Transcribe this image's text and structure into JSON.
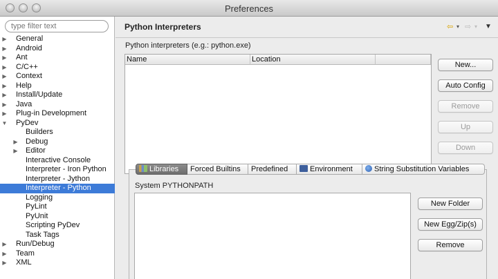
{
  "window": {
    "title": "Preferences"
  },
  "sidebar": {
    "filter_placeholder": "type filter text",
    "items": [
      {
        "label": "General",
        "expander": "collapsed"
      },
      {
        "label": "Android",
        "expander": "collapsed"
      },
      {
        "label": "Ant",
        "expander": "collapsed"
      },
      {
        "label": "C/C++",
        "expander": "collapsed"
      },
      {
        "label": "Context",
        "expander": "collapsed"
      },
      {
        "label": "Help",
        "expander": "collapsed"
      },
      {
        "label": "Install/Update",
        "expander": "collapsed"
      },
      {
        "label": "Java",
        "expander": "collapsed"
      },
      {
        "label": "Plug-in Development",
        "expander": "collapsed"
      },
      {
        "label": "PyDev",
        "expander": "expanded"
      },
      {
        "label": "Builders",
        "expander": "none"
      },
      {
        "label": "Debug",
        "expander": "collapsed"
      },
      {
        "label": "Editor",
        "expander": "collapsed"
      },
      {
        "label": "Interactive Console",
        "expander": "none"
      },
      {
        "label": "Interpreter - Iron Python",
        "expander": "none"
      },
      {
        "label": "Interpreter - Jython",
        "expander": "none"
      },
      {
        "label": "Interpreter - Python",
        "expander": "none",
        "selected": true
      },
      {
        "label": "Logging",
        "expander": "none"
      },
      {
        "label": "PyLint",
        "expander": "none"
      },
      {
        "label": "PyUnit",
        "expander": "none"
      },
      {
        "label": "Scripting PyDev",
        "expander": "none"
      },
      {
        "label": "Task Tags",
        "expander": "none"
      },
      {
        "label": "Run/Debug",
        "expander": "collapsed"
      },
      {
        "label": "Team",
        "expander": "collapsed"
      },
      {
        "label": "XML",
        "expander": "collapsed"
      }
    ]
  },
  "main": {
    "title": "Python Interpreters",
    "nav": {
      "back_icon": "back-arrow-icon",
      "forward_icon": "forward-arrow-icon",
      "menu_icon": "view-menu-icon"
    },
    "interpreters_label": "Python interpreters (e.g.: python.exe)",
    "table_headers": [
      "Name",
      "Location"
    ],
    "buttons": {
      "new": "New...",
      "auto_config": "Auto Config",
      "remove": "Remove",
      "up": "Up",
      "down": "Down"
    },
    "tabs": [
      "Libraries",
      "Forced Builtins",
      "Predefined",
      "Environment",
      "String Substitution Variables"
    ],
    "active_tab": "Libraries",
    "libraries": {
      "label": "System PYTHONPATH",
      "buttons": {
        "new_folder": "New Folder",
        "new_egg": "New Egg/Zip(s)",
        "remove": "Remove"
      }
    }
  },
  "colors": {
    "selection": "#3d7bd8",
    "active_tab": "#7a7a7a",
    "window_bg": "#ececec"
  }
}
